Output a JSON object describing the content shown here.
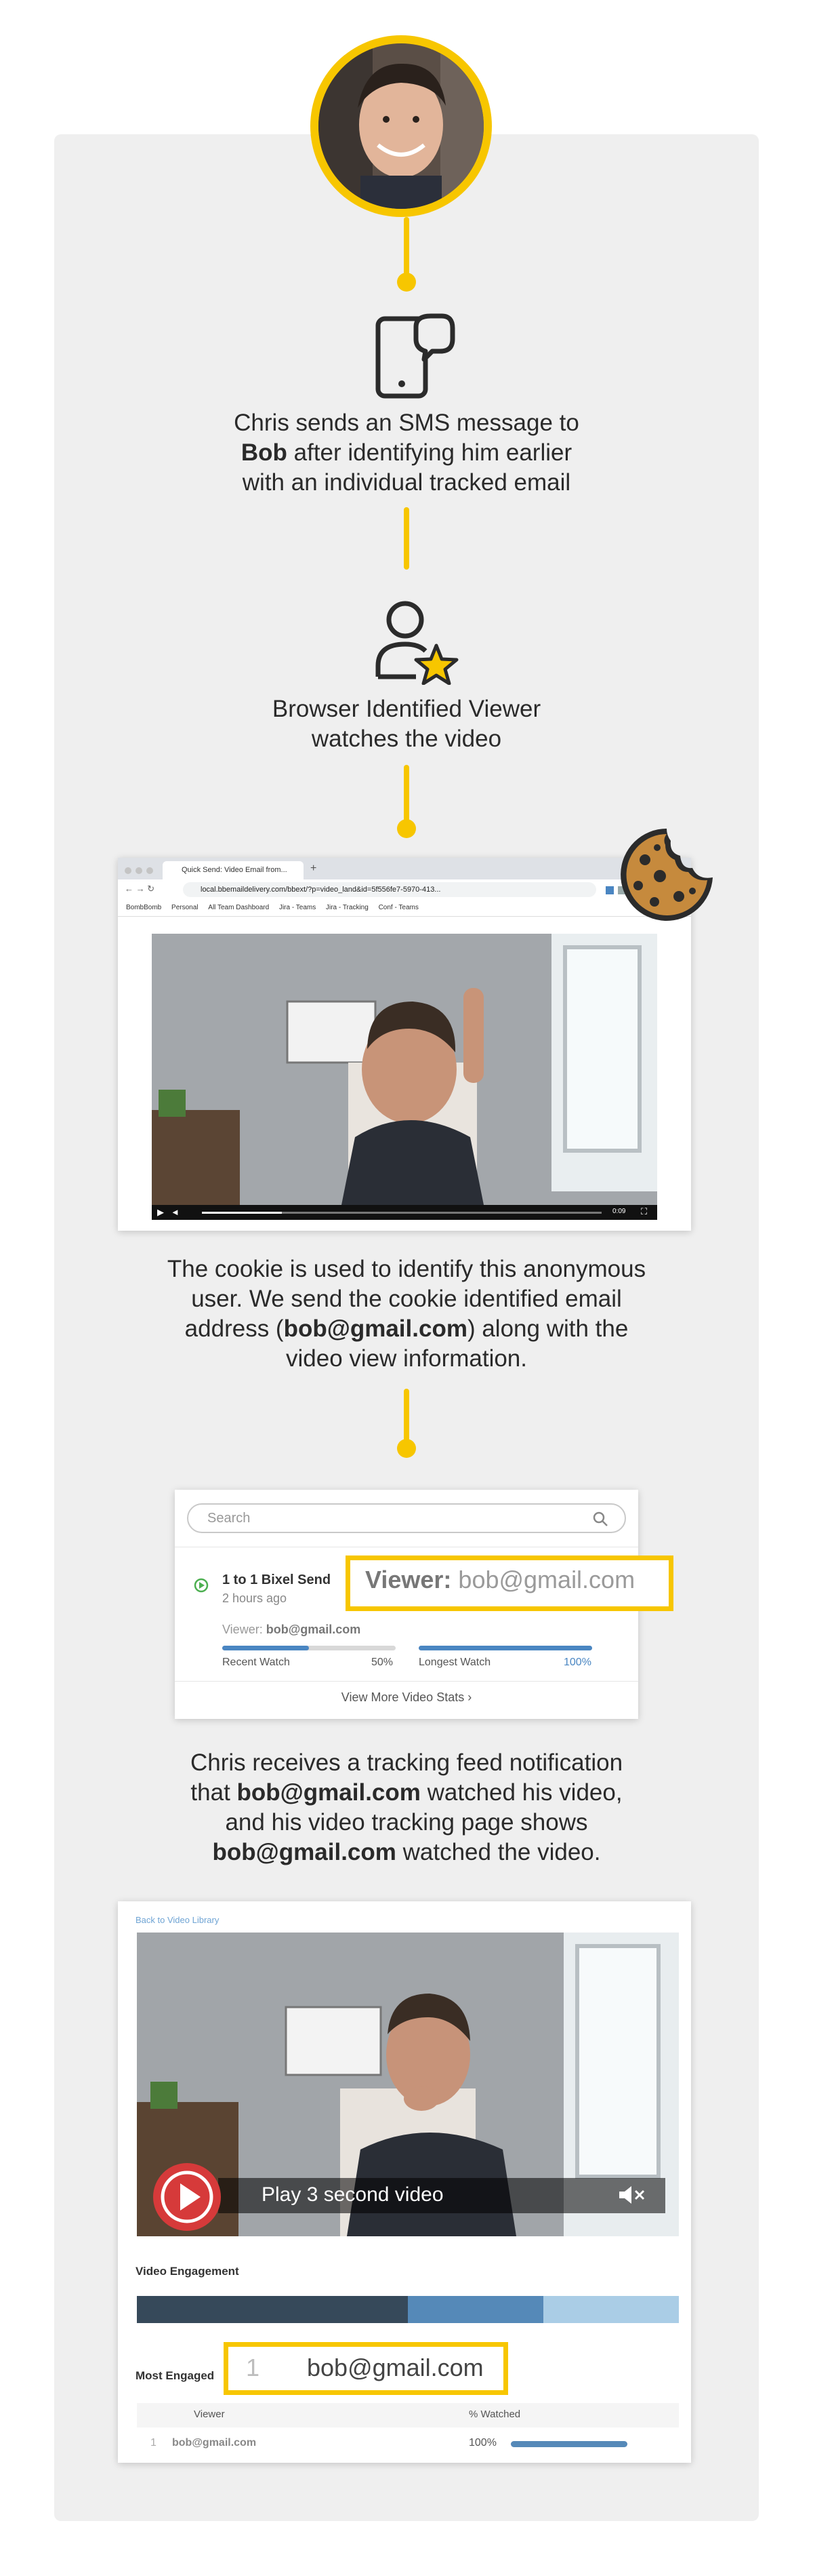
{
  "step1": {
    "caption_line1": "Chris sends an SMS message to",
    "caption_bold": "Bob",
    "caption_line2_rest": " after identifying him earlier",
    "caption_line3": "with an individual tracked email"
  },
  "step2": {
    "caption_line1": "Browser Identified Viewer",
    "caption_line2": "watches the video"
  },
  "browser": {
    "tab_title": "Quick Send: Video Email from...",
    "url": "local.bbemaildelivery.com/bbext/?p=video_land&id=5f556fe7-5970-413...",
    "bookmarks": [
      "BombBomb",
      "Personal",
      "All Team Dashboard",
      "Jira - Teams",
      "Jira - Tracking",
      "Conf - Teams"
    ],
    "video_time": "0:09"
  },
  "step3": {
    "line1": "The cookie is used to identify this anonymous",
    "line2": "user. We send the cookie identified email",
    "line3_pre": "address (",
    "line3_bold": "bob@gmail.com",
    "line3_post": ") along with the",
    "line4": "video view information."
  },
  "feed": {
    "search_placeholder": "Search",
    "item_title": "1 to 1 Bixel Send",
    "item_time": "2 hours ago",
    "viewer_label": "Viewer:",
    "viewer_email": "bob@gmail.com",
    "highlight_label": "Viewer:",
    "highlight_email": "bob@gmail.com",
    "recent_watch_label": "Recent Watch",
    "recent_watch_value": "50%",
    "recent_watch_fraction": 0.5,
    "longest_watch_label": "Longest Watch",
    "longest_watch_value": "100%",
    "longest_watch_fraction": 1.0,
    "more_link": "View More Video Stats ›"
  },
  "step4": {
    "line1": "Chris receives a tracking feed notification",
    "line2_bold": "bob@gmail.com",
    "line2_rest": " watched his video,",
    "line2_pre": "that ",
    "line3": "and his video tracking page shows",
    "line4_bold": "bob@gmail.com",
    "line4_rest": " watched the video."
  },
  "engagement": {
    "back_link": "Back to Video Library",
    "play_label": "Play 3 second video",
    "section_title": "Video Engagement",
    "segments": [
      {
        "fraction": 0.5,
        "color": "#36495a"
      },
      {
        "fraction": 0.25,
        "color": "#5589b8"
      },
      {
        "fraction": 0.25,
        "color": "#aacde6"
      }
    ],
    "most_engaged_label": "Most Engaged",
    "highlight_rank": "1",
    "highlight_email": "bob@gmail.com",
    "table_headers": [
      "Viewer",
      "% Watched"
    ],
    "rows": [
      {
        "rank": "1",
        "viewer": "bob@gmail.com",
        "watched": "100%",
        "fraction": 1.0
      }
    ]
  },
  "colors": {
    "accent": "#f7c600",
    "background_card": "#efefef",
    "link": "#4a86c2"
  }
}
